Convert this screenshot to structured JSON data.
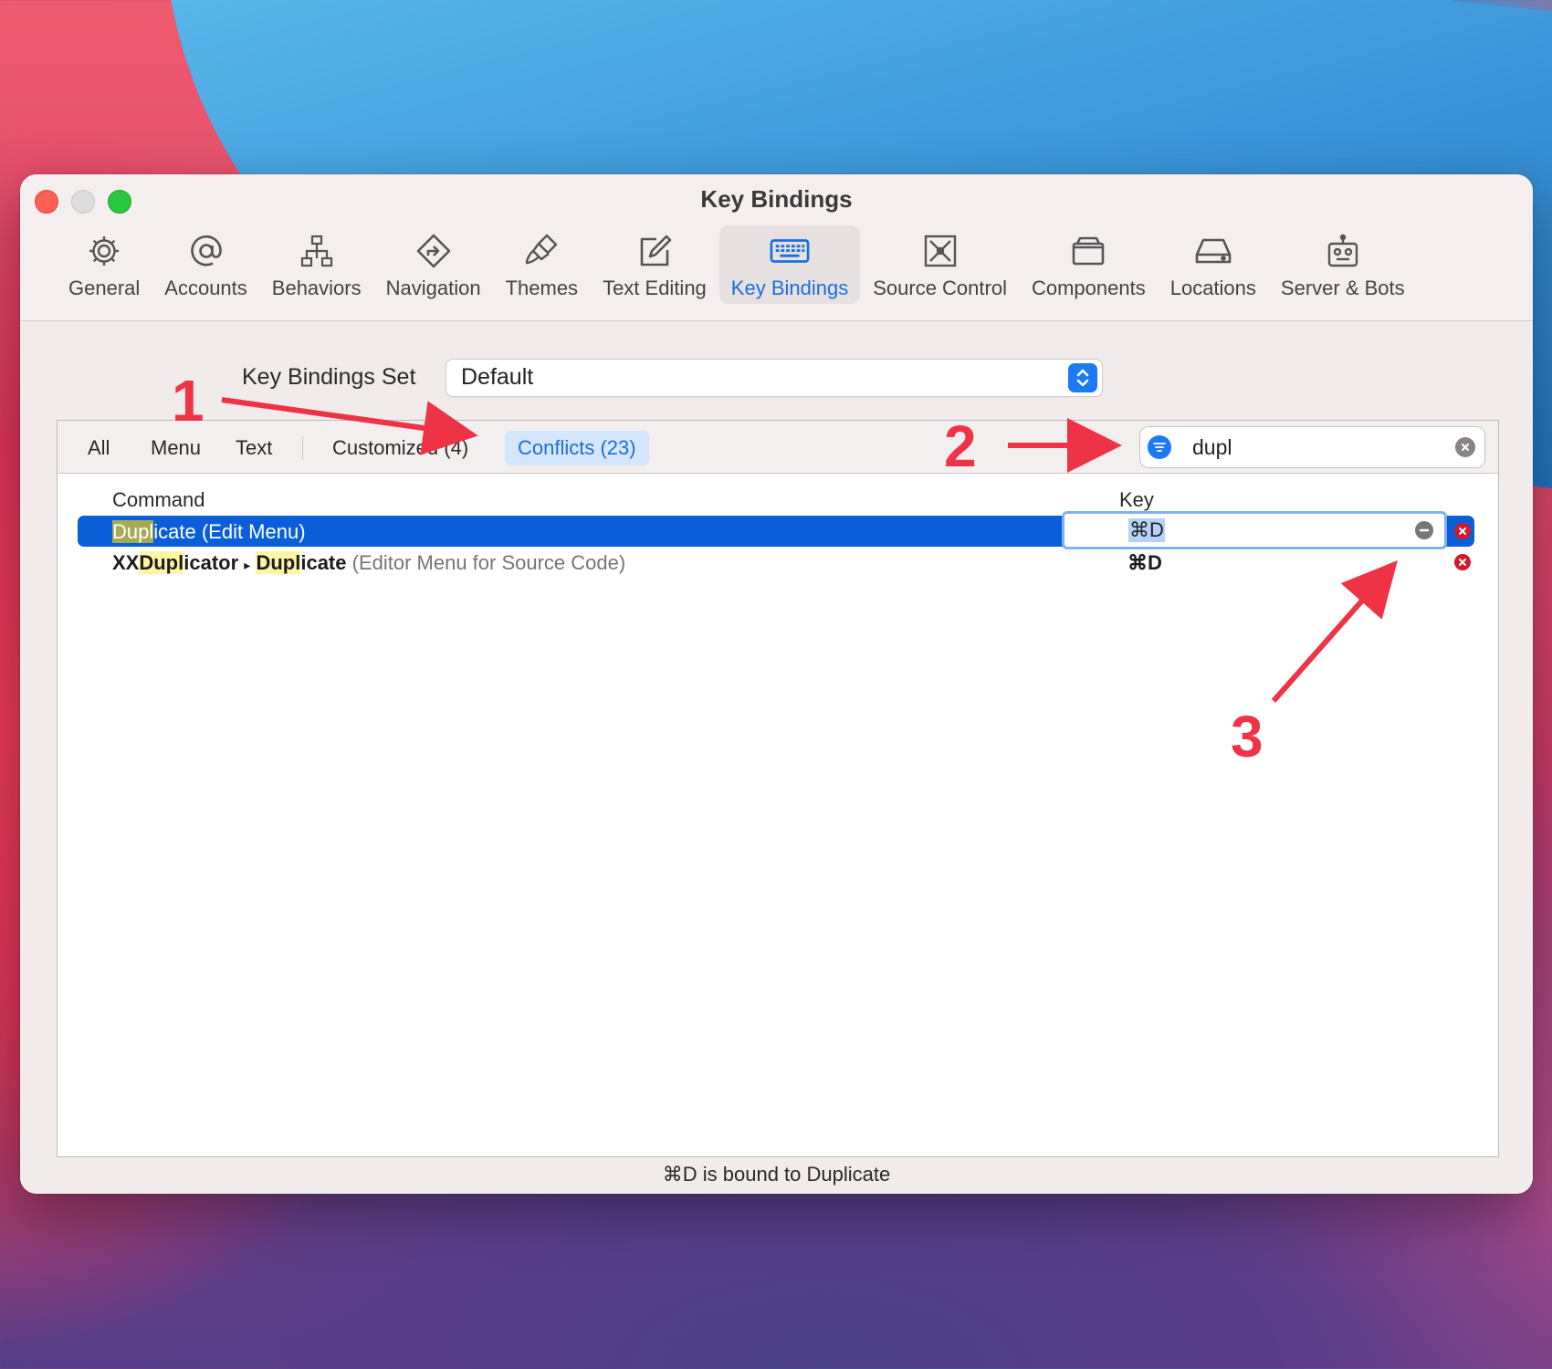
{
  "window": {
    "title": "Key Bindings"
  },
  "toolbar": {
    "items": [
      {
        "label": "General",
        "icon": "gear-icon"
      },
      {
        "label": "Accounts",
        "icon": "at-icon"
      },
      {
        "label": "Behaviors",
        "icon": "hierarchy-icon"
      },
      {
        "label": "Navigation",
        "icon": "route-sign-icon"
      },
      {
        "label": "Themes",
        "icon": "paintbrush-icon"
      },
      {
        "label": "Text Editing",
        "icon": "pencil-square-icon"
      },
      {
        "label": "Key Bindings",
        "icon": "keyboard-icon"
      },
      {
        "label": "Source Control",
        "icon": "source-control-icon"
      },
      {
        "label": "Components",
        "icon": "box-icon"
      },
      {
        "label": "Locations",
        "icon": "drive-icon"
      },
      {
        "label": "Server & Bots",
        "icon": "robot-icon"
      }
    ],
    "selected": "Key Bindings"
  },
  "key_bindings_set": {
    "label": "Key Bindings Set",
    "value": "Default"
  },
  "filters": {
    "all": "All",
    "menu": "Menu",
    "text": "Text",
    "customized": "Customized (4)",
    "conflicts": "Conflicts (23)",
    "selected": "Conflicts (23)"
  },
  "search": {
    "value": "dupl"
  },
  "table": {
    "columns": {
      "command": "Command",
      "key": "Key"
    },
    "rows": [
      {
        "command_highlight": "Dupl",
        "command_rest": "icate (Edit Menu)",
        "key": "⌘D",
        "selected": true
      },
      {
        "prefix_a": "XX",
        "prefix_highlight": "Dupl",
        "prefix_rest": "icator",
        "separator": "▸",
        "name_highlight": "Dupl",
        "name_rest": "icate",
        "context": "(Editor Menu for Source Code)",
        "key": "⌘D",
        "selected": false
      }
    ]
  },
  "status": "⌘D is bound to Duplicate",
  "annotations": {
    "one": "1",
    "two": "2",
    "three": "3"
  },
  "colors": {
    "accent": "#1a7bf2",
    "selection": "#0a5fd9",
    "annotation": "#ef3347",
    "conflict": "#d3182a"
  }
}
